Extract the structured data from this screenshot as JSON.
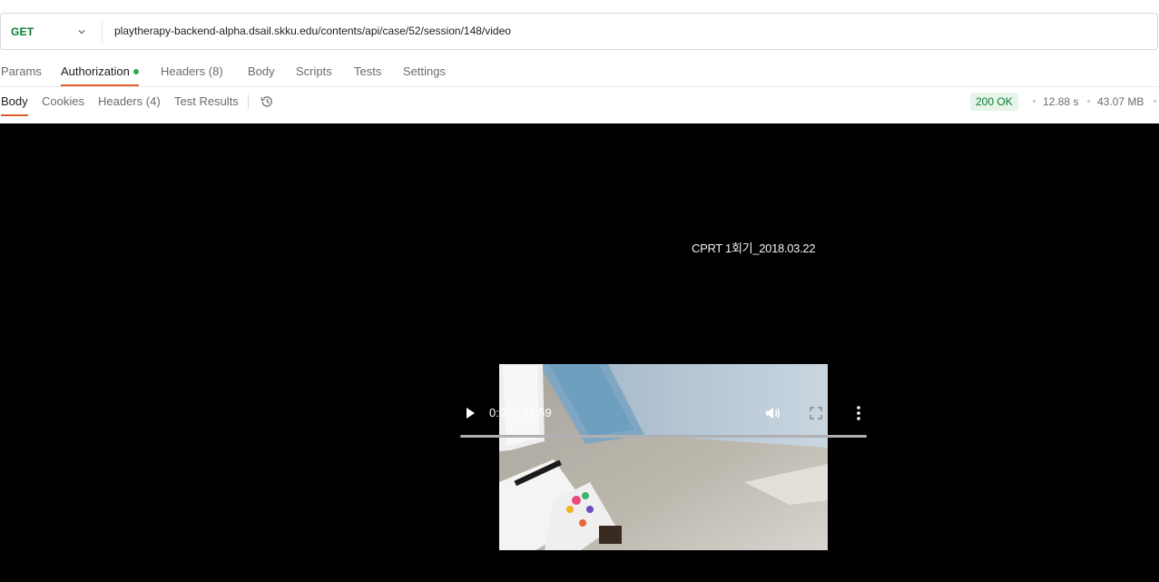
{
  "request": {
    "method": "GET",
    "url": "playtherapy-backend-alpha.dsail.skku.edu/contents/api/case/52/session/148/video"
  },
  "request_tabs": {
    "params": "Params",
    "authorization": "Authorization",
    "headers": "Headers",
    "headers_count": "(8)",
    "body": "Body",
    "scripts": "Scripts",
    "tests": "Tests",
    "settings": "Settings"
  },
  "response_tabs": {
    "body": "Body",
    "cookies": "Cookies",
    "headers": "Headers",
    "headers_count": "(4)",
    "test_results": "Test Results"
  },
  "response_meta": {
    "status": "200 OK",
    "time": "12.88 s",
    "size": "43.07 MB"
  },
  "video": {
    "overlay_text": "CPRT 1회기_2018.03.22",
    "time_display": "0:00 / 22:59",
    "progress_fraction": 0
  },
  "colors": {
    "accent": "#e05d2a",
    "method_green": "#0a7d2f",
    "status_bg": "#e6f4ea"
  },
  "icons": [
    "chevron-down-icon",
    "history-icon",
    "play-icon",
    "volume-icon",
    "fullscreen-icon",
    "more-vert-icon"
  ]
}
